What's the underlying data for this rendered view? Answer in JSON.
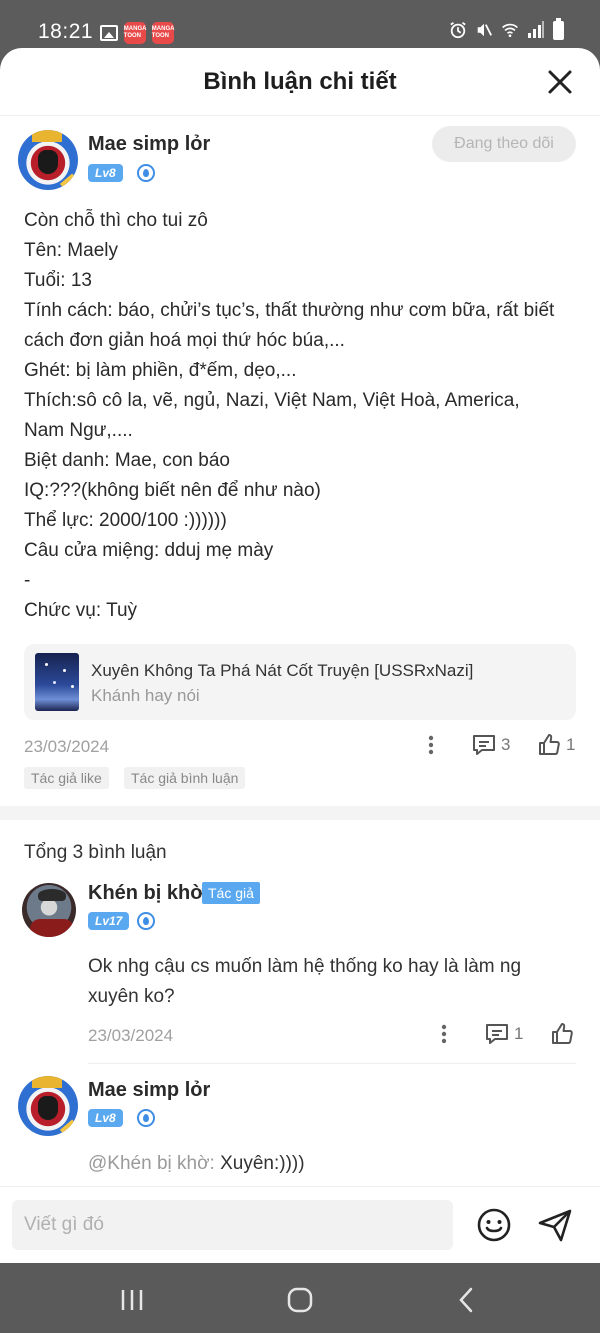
{
  "status_bar": {
    "time": "18:21",
    "app_badges": [
      "MANGA TOON",
      "MANGA TOON"
    ]
  },
  "header": {
    "title": "Bình luận chi tiết"
  },
  "post": {
    "username": "Mae simp lỏr",
    "level": "Lv8",
    "follow_label": "Đang theo dõi",
    "body": "Còn chỗ thì cho tui zô\nTên: Maely\nTuổi: 13\nTính cách: báo, chửi’s tục’s, thất thường như cơm bữa, rất biết cách đơn giản hoá mọi thứ hóc búa,...\nGhét: bị làm phiền, đ*ếm, dẹo,...\nThích:sô cô la, vẽ, ngủ, Nazi, Việt Nam, Việt Hoà, America, Nam Ngư,....\nBiệt danh: Mae, con báo\nIQ:???(không biết nên để như nào)\nThể lực: 2000/100 :))))))\nCâu cửa miệng: dduj mẹ mày\n-\nChức vụ: Tuỳ",
    "story": {
      "title": "Xuyên Không Ta Phá Nát Cốt Truyện [USSRxNazi]",
      "subtitle": "Khánh hay nói"
    },
    "date": "23/03/2024",
    "comment_count": "3",
    "like_count": "1",
    "tags": [
      "Tác giả like",
      "Tác giả bình luận"
    ]
  },
  "comments": {
    "total_label": "Tổng 3 bình luận",
    "items": [
      {
        "username": "Khén bị khờ",
        "author_tag": "Tác giả",
        "level": "Lv17",
        "text": "Ok nhg cậu cs muốn làm hệ thống ko hay là làm ng xuyên ko?",
        "date": "23/03/2024",
        "reply_count": "1"
      },
      {
        "username": "Mae simp lỏr",
        "level": "Lv8",
        "mention": "@Khén bị khờ:",
        "text": " Xuyên:))))"
      }
    ]
  },
  "composer": {
    "placeholder": "Viết gì đó"
  },
  "colors": {
    "accent_blue": "#5aa9f0",
    "sheet_bg": "#ffffff",
    "system_bar": "#5a5a5a"
  },
  "icons": {
    "close": "close-icon",
    "more": "more-vertical-icon",
    "comment": "comment-icon",
    "like": "thumbs-up-icon",
    "emoji": "emoji-icon",
    "send": "send-icon"
  }
}
